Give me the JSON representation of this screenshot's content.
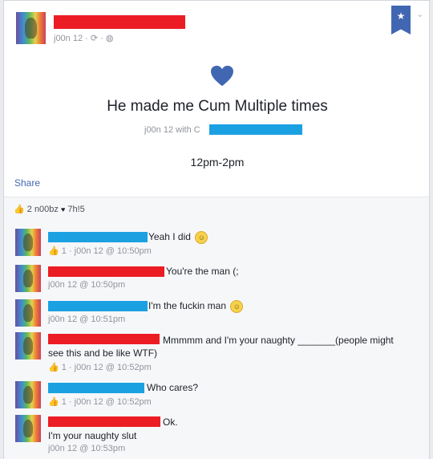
{
  "post": {
    "meta": "j00n 12 · ",
    "meta_icons": "⟳ · ◍",
    "headline": "He made me Cum Multiple times",
    "with_prefix": "j00n 12 with C",
    "time_range": "12pm-2pm",
    "share_label": "Share",
    "bookmark_icon": "star-icon"
  },
  "reactions": {
    "thumb": "👍",
    "summary_left": "2 n00bz",
    "heart": "♥",
    "summary_right": "7h!5"
  },
  "comments": [
    {
      "text": "Yeah I did",
      "emoji": "☺",
      "likes": "1",
      "meta": " · j00n 12 @ 10:50pm"
    },
    {
      "text": "You're the man (;",
      "meta": "j00n 12 @ 10:50pm"
    },
    {
      "text": "I'm the fuckin man",
      "emoji": "☺",
      "meta": "j00n 12 @ 10:51pm"
    },
    {
      "text": "Mmmmm and I'm your naughty _______(people might",
      "text2": "see this and be like WTF)",
      "likes": "1",
      "meta": " · j00n 12 @ 10:52pm"
    },
    {
      "text": "Who cares?",
      "likes": "1",
      "meta": " · j00n 12 @ 10:52pm"
    },
    {
      "text": "Ok.",
      "text2": "I'm your naughty slut",
      "meta": "j00n 12 @ 10:53pm"
    }
  ],
  "colors": {
    "redact_red": "#ec1c24",
    "redact_blue": "#1ba1e2",
    "accent": "#4267b2"
  }
}
